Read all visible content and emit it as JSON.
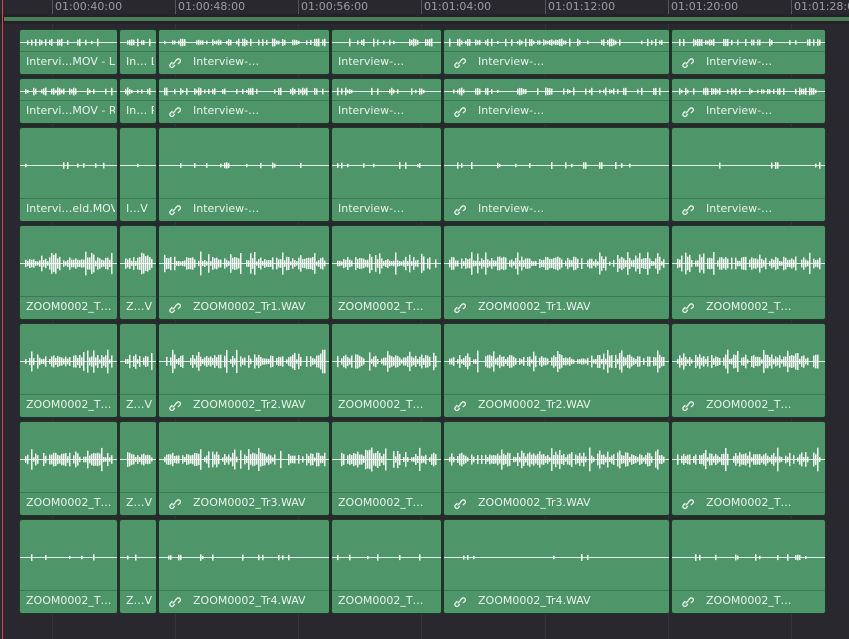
{
  "ruler": {
    "timecodes": [
      "01:00:40:00",
      "01:00:48:00",
      "01:00:56:00",
      "01:01:04:00",
      "01:01:12:00",
      "01:01:20:00",
      "01:01:28:00"
    ]
  },
  "colors": {
    "clip_fill": "#4e9669",
    "clip_border": "#1d3a28",
    "waveform": "#f2f6f3",
    "playhead": "#e0414a",
    "background": "#28282e"
  },
  "tracks": [
    {
      "name": "audio-track-1",
      "clips": [
        {
          "label": "Intervi…MOV - L",
          "linked": false,
          "wave": "sparse"
        },
        {
          "label": "In… L",
          "linked": false,
          "wave": "sparse"
        },
        {
          "label": "Interview-…",
          "linked": true,
          "wave": "sparse"
        },
        {
          "label": "Interview-…",
          "linked": false,
          "wave": "sparse"
        },
        {
          "label": "Interview-…",
          "linked": true,
          "wave": "sparse"
        },
        {
          "label": "Interview-…",
          "linked": true,
          "wave": "sparse"
        }
      ]
    },
    {
      "name": "audio-track-2",
      "clips": [
        {
          "label": "Intervi…MOV - R",
          "linked": false,
          "wave": "sparse"
        },
        {
          "label": "In… R",
          "linked": false,
          "wave": "sparse"
        },
        {
          "label": "Interview-…",
          "linked": true,
          "wave": "sparse"
        },
        {
          "label": "Interview-…",
          "linked": false,
          "wave": "sparse"
        },
        {
          "label": "Interview-…",
          "linked": true,
          "wave": "sparse"
        },
        {
          "label": "Interview-…",
          "linked": true,
          "wave": "sparse"
        }
      ]
    },
    {
      "name": "audio-track-3",
      "clips": [
        {
          "label": "Intervi…eld.MOV",
          "linked": false,
          "wave": "quiet"
        },
        {
          "label": "I…V",
          "linked": false,
          "wave": "quiet"
        },
        {
          "label": "Interview-…",
          "linked": true,
          "wave": "quiet"
        },
        {
          "label": "Interview-…",
          "linked": false,
          "wave": "quiet"
        },
        {
          "label": "Interview-…",
          "linked": true,
          "wave": "quiet"
        },
        {
          "label": "Interview-…",
          "linked": true,
          "wave": "quiet"
        }
      ]
    },
    {
      "name": "audio-track-4",
      "clips": [
        {
          "label": "ZOOM0002_T…",
          "linked": false,
          "wave": "dense"
        },
        {
          "label": "Z…V",
          "linked": false,
          "wave": "dense"
        },
        {
          "label": "ZOOM0002_Tr1.WAV",
          "linked": true,
          "wave": "dense"
        },
        {
          "label": "ZOOM0002_T…",
          "linked": false,
          "wave": "dense"
        },
        {
          "label": "ZOOM0002_Tr1.WAV",
          "linked": true,
          "wave": "dense"
        },
        {
          "label": "ZOOM0002_T…",
          "linked": true,
          "wave": "dense"
        }
      ]
    },
    {
      "name": "audio-track-5",
      "clips": [
        {
          "label": "ZOOM0002_T…",
          "linked": false,
          "wave": "dense"
        },
        {
          "label": "Z…V",
          "linked": false,
          "wave": "dense"
        },
        {
          "label": "ZOOM0002_Tr2.WAV",
          "linked": true,
          "wave": "dense"
        },
        {
          "label": "ZOOM0002_T…",
          "linked": false,
          "wave": "dense"
        },
        {
          "label": "ZOOM0002_Tr2.WAV",
          "linked": true,
          "wave": "dense"
        },
        {
          "label": "ZOOM0002_T…",
          "linked": true,
          "wave": "dense"
        }
      ]
    },
    {
      "name": "audio-track-6",
      "clips": [
        {
          "label": "ZOOM0002_T…",
          "linked": false,
          "wave": "dense"
        },
        {
          "label": "Z…V",
          "linked": false,
          "wave": "dense"
        },
        {
          "label": "ZOOM0002_Tr3.WAV",
          "linked": true,
          "wave": "dense"
        },
        {
          "label": "ZOOM0002_T…",
          "linked": false,
          "wave": "dense"
        },
        {
          "label": "ZOOM0002_Tr3.WAV",
          "linked": true,
          "wave": "dense"
        },
        {
          "label": "ZOOM0002_T…",
          "linked": true,
          "wave": "dense"
        }
      ]
    },
    {
      "name": "audio-track-7",
      "clips": [
        {
          "label": "ZOOM0002_T…",
          "linked": false,
          "wave": "quiet"
        },
        {
          "label": "Z…V",
          "linked": false,
          "wave": "quiet"
        },
        {
          "label": "ZOOM0002_Tr4.WAV",
          "linked": true,
          "wave": "quiet"
        },
        {
          "label": "ZOOM0002_T…",
          "linked": false,
          "wave": "quiet"
        },
        {
          "label": "ZOOM0002_Tr4.WAV",
          "linked": true,
          "wave": "quiet"
        },
        {
          "label": "ZOOM0002_T…",
          "linked": true,
          "wave": "quiet"
        }
      ]
    }
  ]
}
